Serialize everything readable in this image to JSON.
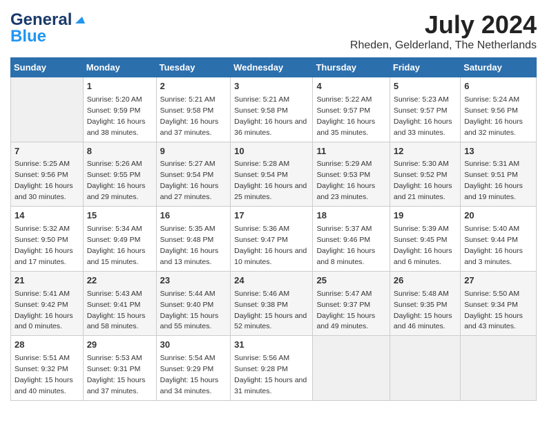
{
  "header": {
    "logo_line1": "General",
    "logo_line2": "Blue",
    "month_year": "July 2024",
    "location": "Rheden, Gelderland, The Netherlands"
  },
  "weekdays": [
    "Sunday",
    "Monday",
    "Tuesday",
    "Wednesday",
    "Thursday",
    "Friday",
    "Saturday"
  ],
  "weeks": [
    [
      {
        "day": "",
        "empty": true
      },
      {
        "day": "1",
        "sunrise": "5:20 AM",
        "sunset": "9:59 PM",
        "daylight": "16 hours and 38 minutes."
      },
      {
        "day": "2",
        "sunrise": "5:21 AM",
        "sunset": "9:58 PM",
        "daylight": "16 hours and 37 minutes."
      },
      {
        "day": "3",
        "sunrise": "5:21 AM",
        "sunset": "9:58 PM",
        "daylight": "16 hours and 36 minutes."
      },
      {
        "day": "4",
        "sunrise": "5:22 AM",
        "sunset": "9:57 PM",
        "daylight": "16 hours and 35 minutes."
      },
      {
        "day": "5",
        "sunrise": "5:23 AM",
        "sunset": "9:57 PM",
        "daylight": "16 hours and 33 minutes."
      },
      {
        "day": "6",
        "sunrise": "5:24 AM",
        "sunset": "9:56 PM",
        "daylight": "16 hours and 32 minutes."
      }
    ],
    [
      {
        "day": "7",
        "sunrise": "5:25 AM",
        "sunset": "9:56 PM",
        "daylight": "16 hours and 30 minutes."
      },
      {
        "day": "8",
        "sunrise": "5:26 AM",
        "sunset": "9:55 PM",
        "daylight": "16 hours and 29 minutes."
      },
      {
        "day": "9",
        "sunrise": "5:27 AM",
        "sunset": "9:54 PM",
        "daylight": "16 hours and 27 minutes."
      },
      {
        "day": "10",
        "sunrise": "5:28 AM",
        "sunset": "9:54 PM",
        "daylight": "16 hours and 25 minutes."
      },
      {
        "day": "11",
        "sunrise": "5:29 AM",
        "sunset": "9:53 PM",
        "daylight": "16 hours and 23 minutes."
      },
      {
        "day": "12",
        "sunrise": "5:30 AM",
        "sunset": "9:52 PM",
        "daylight": "16 hours and 21 minutes."
      },
      {
        "day": "13",
        "sunrise": "5:31 AM",
        "sunset": "9:51 PM",
        "daylight": "16 hours and 19 minutes."
      }
    ],
    [
      {
        "day": "14",
        "sunrise": "5:32 AM",
        "sunset": "9:50 PM",
        "daylight": "16 hours and 17 minutes."
      },
      {
        "day": "15",
        "sunrise": "5:34 AM",
        "sunset": "9:49 PM",
        "daylight": "16 hours and 15 minutes."
      },
      {
        "day": "16",
        "sunrise": "5:35 AM",
        "sunset": "9:48 PM",
        "daylight": "16 hours and 13 minutes."
      },
      {
        "day": "17",
        "sunrise": "5:36 AM",
        "sunset": "9:47 PM",
        "daylight": "16 hours and 10 minutes."
      },
      {
        "day": "18",
        "sunrise": "5:37 AM",
        "sunset": "9:46 PM",
        "daylight": "16 hours and 8 minutes."
      },
      {
        "day": "19",
        "sunrise": "5:39 AM",
        "sunset": "9:45 PM",
        "daylight": "16 hours and 6 minutes."
      },
      {
        "day": "20",
        "sunrise": "5:40 AM",
        "sunset": "9:44 PM",
        "daylight": "16 hours and 3 minutes."
      }
    ],
    [
      {
        "day": "21",
        "sunrise": "5:41 AM",
        "sunset": "9:42 PM",
        "daylight": "16 hours and 0 minutes."
      },
      {
        "day": "22",
        "sunrise": "5:43 AM",
        "sunset": "9:41 PM",
        "daylight": "15 hours and 58 minutes."
      },
      {
        "day": "23",
        "sunrise": "5:44 AM",
        "sunset": "9:40 PM",
        "daylight": "15 hours and 55 minutes."
      },
      {
        "day": "24",
        "sunrise": "5:46 AM",
        "sunset": "9:38 PM",
        "daylight": "15 hours and 52 minutes."
      },
      {
        "day": "25",
        "sunrise": "5:47 AM",
        "sunset": "9:37 PM",
        "daylight": "15 hours and 49 minutes."
      },
      {
        "day": "26",
        "sunrise": "5:48 AM",
        "sunset": "9:35 PM",
        "daylight": "15 hours and 46 minutes."
      },
      {
        "day": "27",
        "sunrise": "5:50 AM",
        "sunset": "9:34 PM",
        "daylight": "15 hours and 43 minutes."
      }
    ],
    [
      {
        "day": "28",
        "sunrise": "5:51 AM",
        "sunset": "9:32 PM",
        "daylight": "15 hours and 40 minutes."
      },
      {
        "day": "29",
        "sunrise": "5:53 AM",
        "sunset": "9:31 PM",
        "daylight": "15 hours and 37 minutes."
      },
      {
        "day": "30",
        "sunrise": "5:54 AM",
        "sunset": "9:29 PM",
        "daylight": "15 hours and 34 minutes."
      },
      {
        "day": "31",
        "sunrise": "5:56 AM",
        "sunset": "9:28 PM",
        "daylight": "15 hours and 31 minutes."
      },
      {
        "day": "",
        "empty": true
      },
      {
        "day": "",
        "empty": true
      },
      {
        "day": "",
        "empty": true
      }
    ]
  ]
}
